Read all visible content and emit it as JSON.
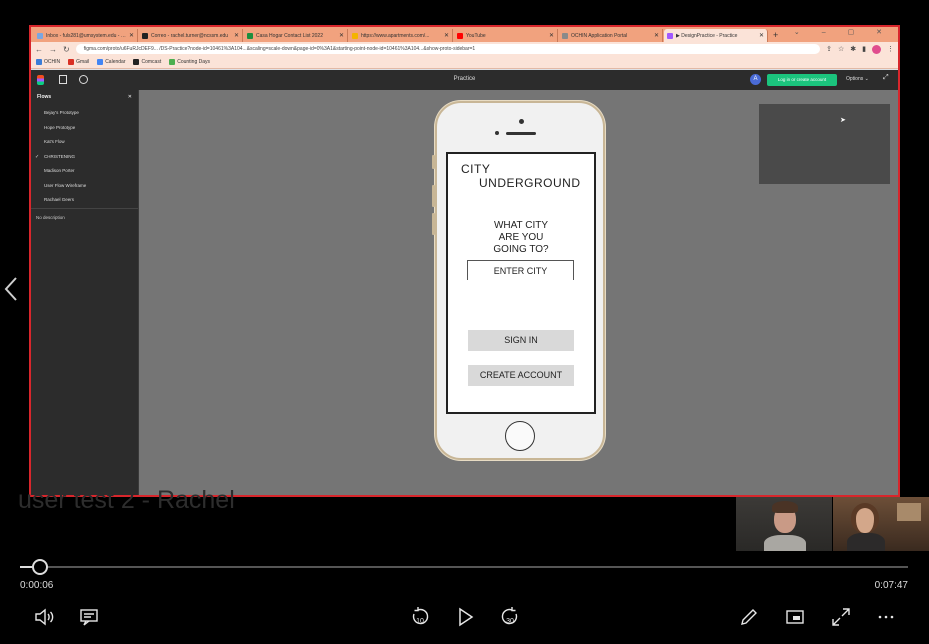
{
  "browser": {
    "tabs": [
      {
        "label": "Inbox - fuls281@umsystem.edu - Lit",
        "favicon_color": "#7aa6e0",
        "active": false
      },
      {
        "label": "Correo - rachel.turner@ncssm.edu",
        "favicon_color": "#222222",
        "active": false
      },
      {
        "label": "Casa Hogar Contact List 2022",
        "favicon_color": "#1e8e3e",
        "active": false
      },
      {
        "label": "https://www.apartments.com/...",
        "favicon_color": "#f4b400",
        "active": false
      },
      {
        "label": "YouTube",
        "favicon_color": "#ff0000",
        "active": false
      },
      {
        "label": "OCHIN Application Portal",
        "favicon_color": "#8a8a8a",
        "active": false
      },
      {
        "label": "▶ DesignPractice - Practice",
        "favicon_color": "#a259ff",
        "active": true
      }
    ],
    "new_tab": "+",
    "url": "figma.com/proto/u6FuRJcDEF9... /DS-Practice?node-id=10461%3A104...&scaling=scale-down&page-id=0%3A1&starting-point-node-id=10461%3A104...&show-proto-sidebar=1",
    "bookmarks": [
      {
        "label": "OCHIN",
        "icon_color": "#3b7dd8"
      },
      {
        "label": "Gmail",
        "icon_color": "#d93025"
      },
      {
        "label": "Calendar",
        "icon_color": "#4285f4"
      },
      {
        "label": "Comcast",
        "icon_color": "#222222"
      },
      {
        "label": "Counting Days",
        "icon_color": "#4caf50"
      }
    ]
  },
  "figma": {
    "title": "Practice",
    "avatar_letter": "A",
    "login_button": "Log in or create account",
    "options_label": "Options ⌄",
    "flows_panel": {
      "heading": "Flows",
      "close": "✕",
      "items": [
        {
          "label": "Bejay's Prototype",
          "checked": false
        },
        {
          "label": "Hope Prototype",
          "checked": false
        },
        {
          "label": "Kat's Flow",
          "checked": false
        },
        {
          "label": "CHRISTENING",
          "checked": true
        },
        {
          "label": "Madison Porter",
          "checked": false
        },
        {
          "label": "User Flow Wireframe",
          "checked": false
        },
        {
          "label": "Rachael Geers",
          "checked": false
        }
      ],
      "description": "No description"
    },
    "prototype": {
      "title_line_1": "CITY",
      "title_line_2": "UNDERGROUND",
      "question": "WHAT CITY\nARE YOU\nGOING TO?",
      "city_input": "ENTER CITY",
      "signin_button": "SIGN  IN",
      "create_button": "CREATE ACCOUNT"
    }
  },
  "video": {
    "title": "user test 2 - Rachel",
    "current_time": "0:00:06",
    "total_time": "0:07:47",
    "progress_percent": 1.3,
    "skip_back_label": "10",
    "skip_forward_label": "30"
  }
}
